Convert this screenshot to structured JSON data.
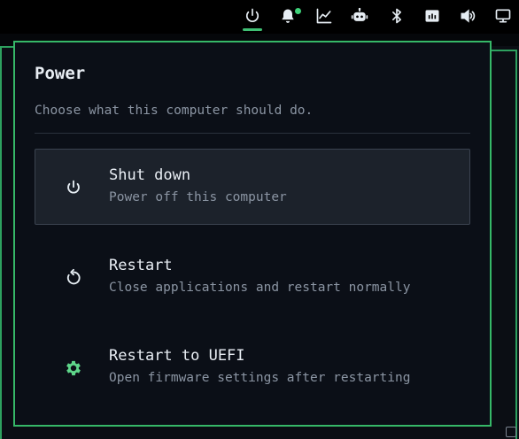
{
  "topbar": {
    "icons": [
      "power-icon",
      "bell-icon",
      "chart-icon",
      "robot-icon",
      "bluetooth-icon",
      "network-icon",
      "volume-icon",
      "display-icon"
    ],
    "accent_color": "#3fbf74",
    "notification_dot_color": "#3fd27a"
  },
  "popup": {
    "title": "Power",
    "subtitle": "Choose what this computer should do.",
    "border_color": "#36b868",
    "options": [
      {
        "icon": "power-icon",
        "label": "Shut down",
        "description": "Power off this computer",
        "selected": true
      },
      {
        "icon": "restart-icon",
        "label": "Restart",
        "description": "Close applications and restart normally",
        "selected": false
      },
      {
        "icon": "gear-icon",
        "label": "Restart to UEFI",
        "description": "Open firmware settings after restarting",
        "selected": false
      }
    ]
  }
}
